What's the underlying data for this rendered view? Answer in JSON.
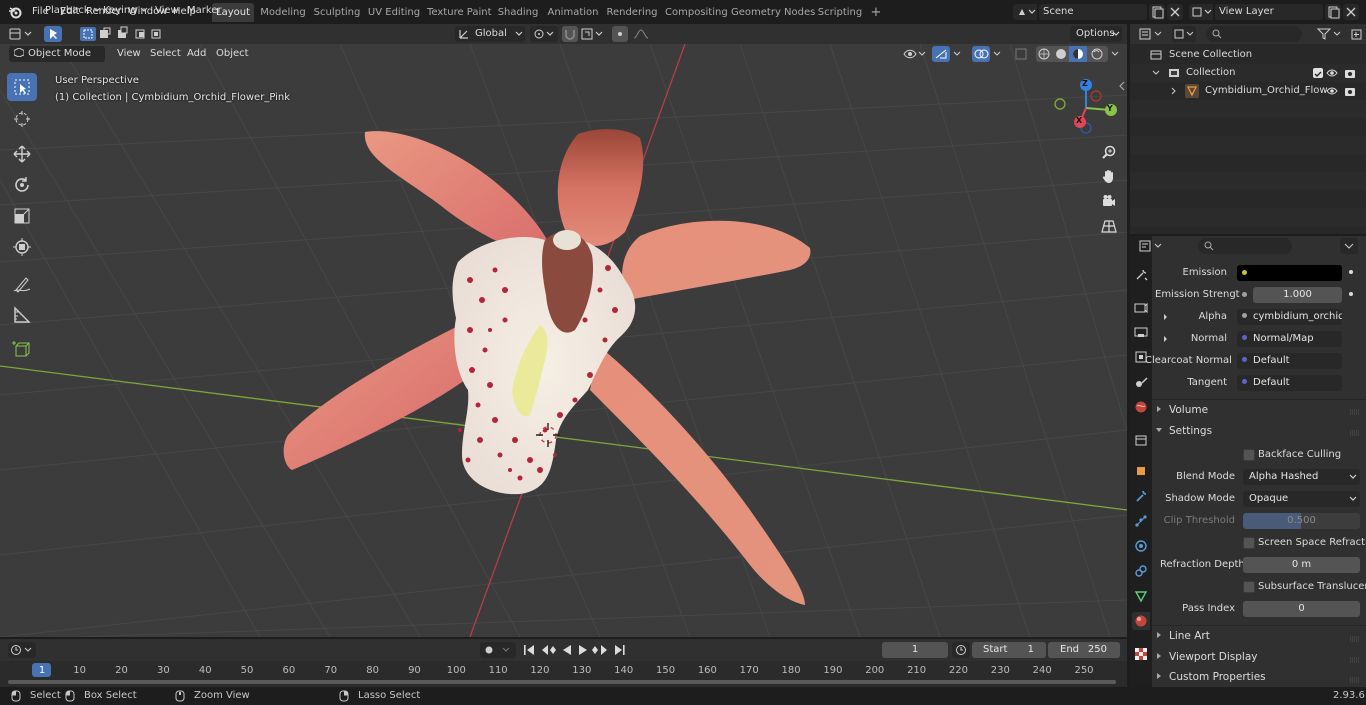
{
  "topbar": {
    "menus": [
      "File",
      "Edit",
      "Render",
      "Window",
      "Help"
    ],
    "workspaces": [
      "Layout",
      "Modeling",
      "Sculpting",
      "UV Editing",
      "Texture Paint",
      "Shading",
      "Animation",
      "Rendering",
      "Compositing",
      "Geometry Nodes",
      "Scripting"
    ],
    "active_workspace": "Layout",
    "add_workspace": "+",
    "scene": "Scene",
    "view_layer": "View Layer"
  },
  "tool_header": {
    "orientation": "Global",
    "options": "Options"
  },
  "viewport_header": {
    "mode": "Object Mode",
    "menus": [
      "View",
      "Select",
      "Add",
      "Object"
    ]
  },
  "viewport": {
    "perspective": "User Perspective",
    "collection_info": "(1) Collection | Cymbidium_Orchid_Flower_Pink",
    "gizmo_axes": {
      "x": "X",
      "y": "Y",
      "z": "Z"
    }
  },
  "outliner": {
    "scene_collection": "Scene Collection",
    "collection": "Collection",
    "object": "Cymbidium_Orchid_Flow"
  },
  "properties": {
    "rows": [
      {
        "label": "Emission",
        "value": "",
        "socket_color": "#c7c729"
      },
      {
        "label": "Emission Strengt",
        "value": "1.000",
        "socket_color": "#a1a1a1"
      },
      {
        "label": "Alpha",
        "value": "cymbidium_orchid_g...",
        "socket_color": "#a1a1a1"
      },
      {
        "label": "Normal",
        "value": "Normal/Map",
        "socket_color": "#6363c7"
      },
      {
        "label": "Clearcoat Normal",
        "value": "Default",
        "socket_color": "#6363c7"
      },
      {
        "label": "Tangent",
        "value": "Default",
        "socket_color": "#6363c7"
      }
    ],
    "panels": {
      "volume": "Volume",
      "settings": "Settings",
      "line_art": "Line Art",
      "viewport_display": "Viewport Display",
      "custom_properties": "Custom Properties"
    },
    "settings": {
      "backface_culling": "Backface Culling",
      "blend_mode_label": "Blend Mode",
      "blend_mode": "Alpha Hashed",
      "shadow_mode_label": "Shadow Mode",
      "shadow_mode": "Opaque",
      "clip_threshold_label": "Clip Threshold",
      "clip_threshold": "0.500",
      "screen_space_refraction": "Screen Space Refraction",
      "refraction_depth_label": "Refraction Depth",
      "refraction_depth": "0 m",
      "subsurface_translucency": "Subsurface Translucency",
      "pass_index_label": "Pass Index",
      "pass_index": "0"
    }
  },
  "timeline": {
    "menus": [
      "Playback",
      "Keying",
      "View",
      "Marker"
    ],
    "current_frame": "1",
    "start_label": "Start",
    "start": "1",
    "end_label": "End",
    "end": "250",
    "ruler": [
      "1",
      "10",
      "20",
      "30",
      "40",
      "50",
      "60",
      "70",
      "80",
      "90",
      "100",
      "110",
      "120",
      "130",
      "140",
      "150",
      "160",
      "170",
      "180",
      "190",
      "200",
      "210",
      "220",
      "230",
      "240",
      "250"
    ]
  },
  "statusbar": {
    "select": "Select",
    "box_select": "Box Select",
    "zoom_view": "Zoom View",
    "lasso_select": "Lasso Select",
    "version": "2.93.6"
  },
  "colors": {
    "accent": "#4772b3",
    "x_axis": "#e0455a",
    "y_axis": "#8bc34a",
    "z_axis": "#2f84e3"
  }
}
